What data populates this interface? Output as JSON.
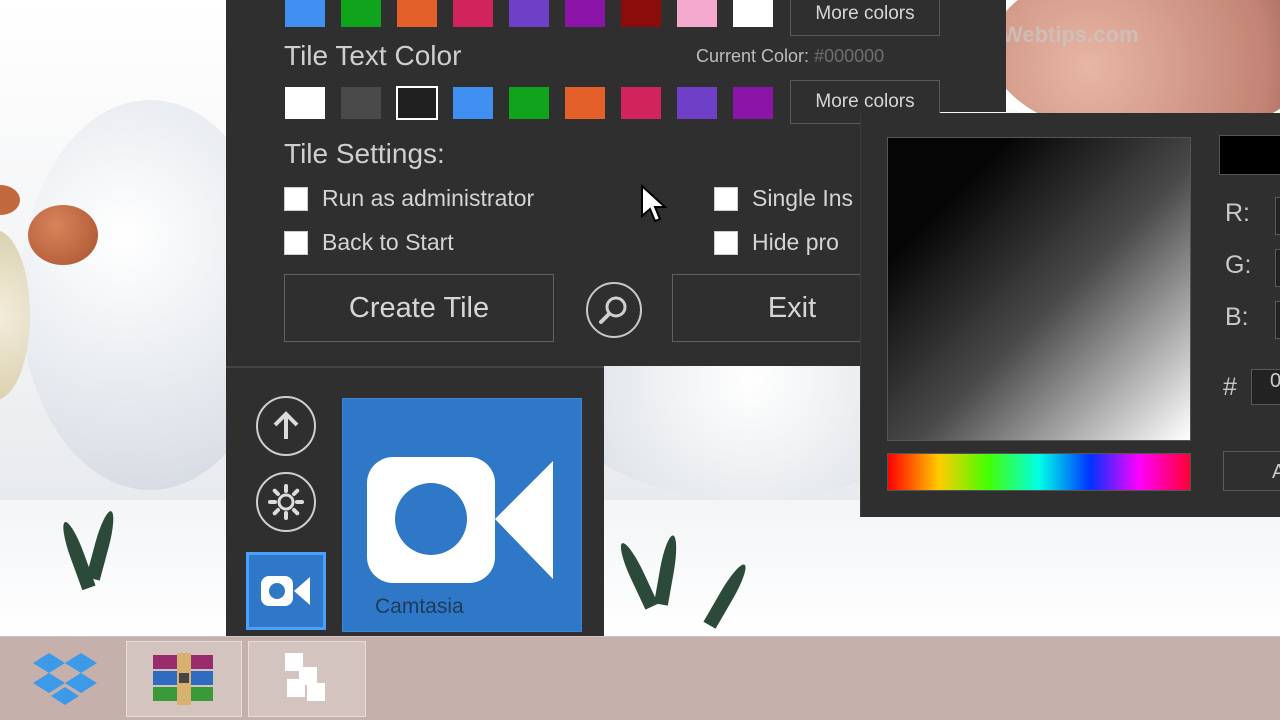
{
  "watermark": "Webtips.com",
  "tile_color_row": {
    "swatches": [
      "#3f8ff0",
      "#0fa41c",
      "#e3602a",
      "#d2245c",
      "#6f3fc7",
      "#8a15a8",
      "#8c0c0c",
      "#f5a9cf",
      "#ffffff"
    ],
    "more_colors_label": "More colors"
  },
  "tile_text_color": {
    "title": "Tile Text Color",
    "current_color_label": "Current Color:",
    "current_color_value": "#000000",
    "swatches": [
      "#ffffff",
      "#4a4a4a",
      "#202020",
      "#3f8ff0",
      "#0fa41c",
      "#e3602a",
      "#d2245c",
      "#6f3fc7",
      "#8a15a8"
    ],
    "selected_index": 2,
    "more_colors_label": "More colors"
  },
  "tile_settings": {
    "title": "Tile Settings:",
    "options": [
      {
        "label": "Run as administrator",
        "checked": false
      },
      {
        "label": "Single Ins",
        "checked": false
      },
      {
        "label": "Back to Start",
        "checked": false
      },
      {
        "label": "Hide pro",
        "checked": false
      }
    ]
  },
  "actions": {
    "create_label": "Create Tile",
    "exit_label": "Exit"
  },
  "preview": {
    "tile_name": "Camtasia",
    "tile_color": "#2e78c7"
  },
  "color_picker": {
    "r_label": "R:",
    "g_label": "G:",
    "b_label": "B:",
    "hash_label": "#",
    "hex_value_visible": "0",
    "apply_label": "A",
    "selected_color": "#000000"
  },
  "taskbar": {
    "items": [
      "dropbox-icon",
      "winrar-icon",
      "start-tiles-icon"
    ]
  }
}
